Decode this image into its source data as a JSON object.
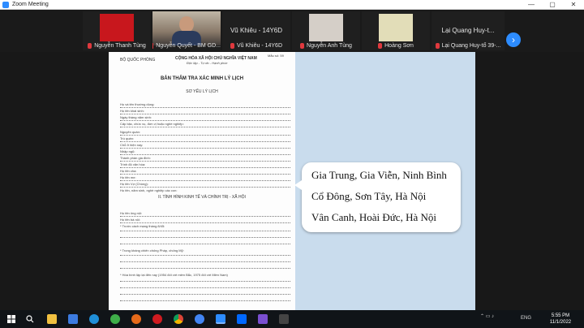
{
  "window": {
    "title": "Zoom Meeting",
    "controls": [
      "—",
      "▢",
      "✕"
    ]
  },
  "participants": [
    {
      "name": "Nguyễn Thanh Tùng",
      "muted": true,
      "has_video": false,
      "tile_color": "#c8171d"
    },
    {
      "name": "Nguyễn Quyết - BM GD...",
      "muted": true,
      "has_video": true,
      "tile_color": "#8a7a6a"
    },
    {
      "name": "Vũ Khiêu - 14Y6D",
      "muted": true,
      "has_video": false,
      "tile_color": "#1f1f1f"
    },
    {
      "name": "Nguyễn Anh Tùng",
      "muted": true,
      "has_video": false,
      "tile_color": "#d5cfc8"
    },
    {
      "name": "Hoàng Sơn",
      "muted": true,
      "has_video": false,
      "tile_color": "#e2ddb8"
    },
    {
      "name": "Lại Quang Huy-t...",
      "muted": true,
      "has_video": false,
      "tile_color": "#1f1f1f"
    },
    {
      "name": "Lại Quang Huy-tổ 39-...",
      "muted": true,
      "has_video": false,
      "tile_color": "#1f1f1f"
    }
  ],
  "next_page_icon": "chevron-right-icon",
  "document": {
    "agency": "BỘ QUỐC PHÒNG",
    "nation": "CỘNG HÒA XÃ HỘI CHỦ NGHĨA VIỆT NAM",
    "motto": "Độc lập - Tự do - Hạnh phúc",
    "form_no": "Mẫu số: 59",
    "title": "BẢN THẨM TRA XÁC MINH LÝ LỊCH",
    "subtitle": "SƠ YẾU LÝ LỊCH",
    "fields": [
      "Họ và tên thường dùng:",
      "Họ tên khai sinh:",
      "Ngày tháng năm sinh:",
      "Cấp bậc, chức vụ, đơn vị hoặc nghề nghiệp:",
      "Nguyên quán:",
      "Trú quán:",
      "Chỗ ở hiện nay:",
      "Nhập ngũ:",
      "Thành phần gia đình:",
      "Trình độ văn hóa:",
      "Họ tên cha:",
      "Họ tên mẹ:",
      "Họ tên Vợ (Chồng):",
      "Họ tên, năm sinh, nghề nghiệp các con:"
    ],
    "section2": "II. TÌNH HÌNH KINH TẾ VÀ CHÍNH TRỊ - XÃ HỘI",
    "section2_fields": [
      "Họ tên ông nội:",
      "Họ tên bà nội:",
      "* Trước cách mạng tháng 8/45:",
      "* Trong kháng chiến chống Pháp, chống Mỹ:",
      "* Hòa bình lập lại đến nay (1954 đối với miền Bắc, 1975 đối với Miền Nam)"
    ]
  },
  "callout": {
    "lines": [
      "Gia Trung, Gia Viễn, Ninh Bình",
      "Cổ Đông, Sơn Tây, Hà Nội",
      "Vân Canh, Hoài Đức, Hà Nội"
    ]
  },
  "taskbar": {
    "apps": [
      "windows-icon",
      "search-icon",
      "file-explorer-icon",
      "store-icon",
      "edge-icon",
      "greenshot-icon",
      "firefox-icon",
      "opera-icon",
      "chrome-icon",
      "zoom-icon",
      "zalo-icon",
      "unikey-icon",
      "app-icon"
    ],
    "language": "ENG",
    "time": "5:55 PM",
    "date": "11/1/2022"
  }
}
